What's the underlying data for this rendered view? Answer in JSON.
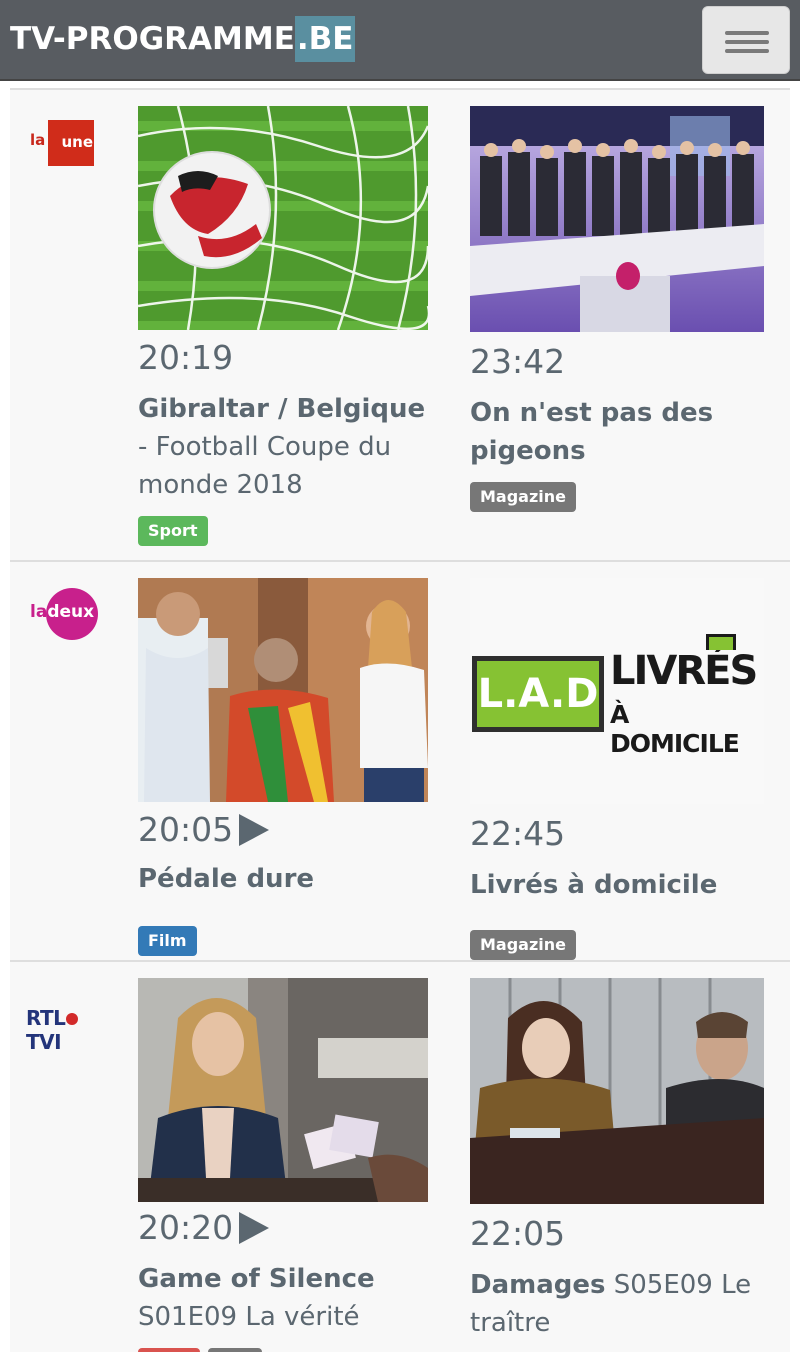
{
  "header": {
    "brand_main": "TV-PROGRAMME",
    "brand_tld": ".BE",
    "menu_icon": "hamburger-icon"
  },
  "channels": [
    {
      "logo_text_la": "la",
      "logo_text_main": "une",
      "programs": [
        {
          "time": "20:19",
          "title_bold": "Gibraltar / Belgique",
          "title_rest": " - Football Coupe du monde 2018",
          "badge": "Sport"
        },
        {
          "time": "23:42",
          "title_bold": "On n'est pas des pigeons",
          "title_rest": "",
          "badge": "Magazine"
        }
      ]
    },
    {
      "logo_text_la": "la",
      "logo_text_main": "deux",
      "programs": [
        {
          "time": "20:05",
          "title_bold": "Pédale dure",
          "title_rest": "",
          "badge": "Film"
        },
        {
          "time": "22:45",
          "title_bold": "Livrés à domicile",
          "title_rest": "",
          "badge": "Magazine",
          "logo_text_1": "L.A.D",
          "logo_text_2": "LIVRÉS",
          "logo_text_3": "À DOMICILE"
        }
      ]
    },
    {
      "logo_text_rtl": "RTL",
      "logo_text_tvi": "TVI",
      "programs": [
        {
          "time": "20:20",
          "title_bold": "Game of Silence",
          "title_rest": "S01E09 La vérité"
        },
        {
          "time": "22:05",
          "title_bold": "Damages",
          "title_rest": " S05E09 Le traître"
        }
      ]
    }
  ],
  "colors": {
    "navbar": "#585c61",
    "brand_tld_bg": "#5a8fa0",
    "sport": "#5cb85c",
    "film": "#337ab7",
    "magazine": "#777777"
  }
}
